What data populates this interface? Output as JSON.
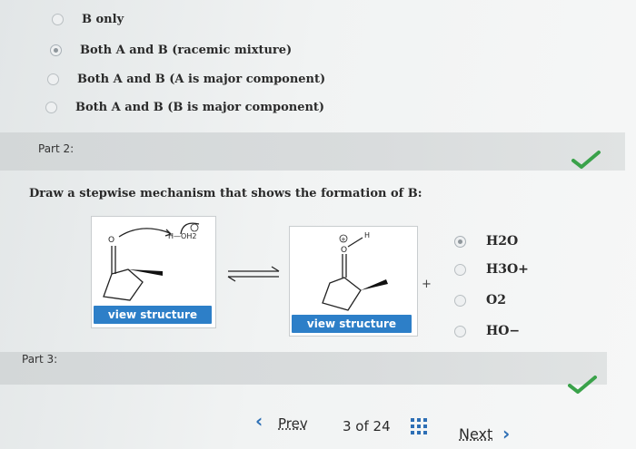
{
  "part1": {
    "options": [
      {
        "label": "B only",
        "selected": false
      },
      {
        "label": "Both A and B (racemic mixture)",
        "selected": true
      },
      {
        "label": "Both A and B (A is major component)",
        "selected": false
      },
      {
        "label": "Both A and B (B is major component)",
        "selected": false
      }
    ]
  },
  "part2": {
    "title": "Part 2:",
    "status": "correct",
    "prompt": "Draw a stepwise mechanism that shows the formation of B:",
    "structure1": {
      "view_button": "view structure",
      "reagent_label": "H—OH2"
    },
    "structure2": {
      "view_button": "view structure"
    },
    "plus": "+",
    "reagents": [
      {
        "label": "H2O",
        "selected": true
      },
      {
        "label": "H3O+",
        "selected": false
      },
      {
        "label": "O2",
        "selected": false
      },
      {
        "label": "HO−",
        "selected": false
      }
    ]
  },
  "part3": {
    "title": "Part 3:",
    "status": "correct"
  },
  "pagination": {
    "prev": "Prev",
    "counter": "3 of 24",
    "next": "Next"
  },
  "colors": {
    "check": "#3aa24a",
    "button": "#2d7fc8",
    "chevron": "#2d6fb5"
  }
}
